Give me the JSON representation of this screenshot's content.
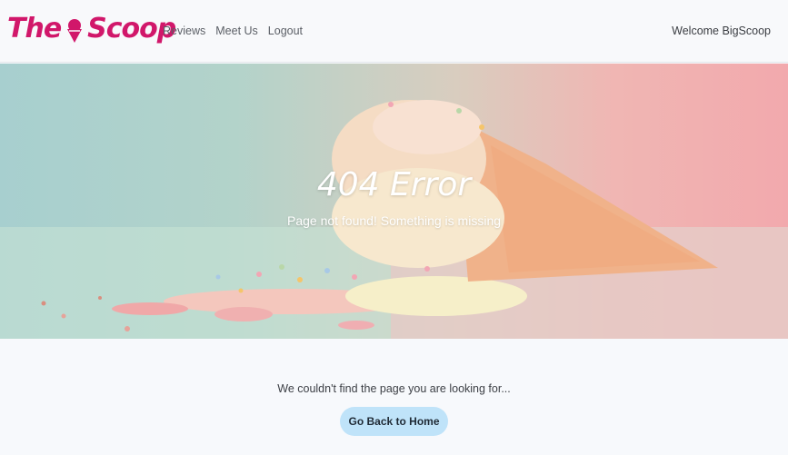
{
  "navbar": {
    "brand_left": "The",
    "brand_right": "Scoop",
    "brand_icon": "ice-cream-icon",
    "links": [
      "Reviews",
      "Meet Us",
      "Logout"
    ],
    "welcome": "Welcome BigScoop"
  },
  "hero": {
    "title": "404 Error",
    "subtitle": "Page not found! Something is missing"
  },
  "main": {
    "message": "We couldn't find the page you are looking for...",
    "button_label": "Go Back to Home"
  },
  "colors": {
    "brand": "#d1176a",
    "button": "#bfe3f9"
  }
}
